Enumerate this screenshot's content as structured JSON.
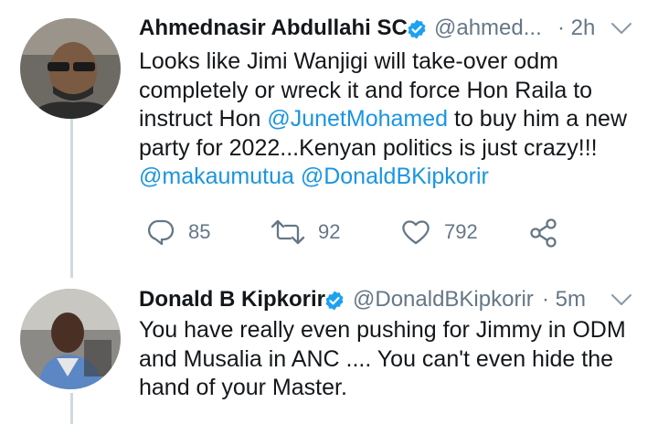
{
  "tweets": [
    {
      "name": "Ahmednasir Abdullahi SC",
      "handle": "@ahmed...",
      "time": "· 2h",
      "lines": [
        {
          "text": "Looks like Jimi Wanjigi will take-over odm"
        },
        {
          "text": "completely or wreck it and force Hon Raila to"
        },
        {
          "pre": "instruct Hon ",
          "mention": "@JunetMohamed",
          "post": " to buy him a new"
        },
        {
          "text": "party for 2022...Kenyan politics is just crazy!!!"
        },
        {
          "mentions": "@makaumutua @DonaldBKipkorir"
        }
      ],
      "actions": {
        "replies": "85",
        "retweets": "92",
        "likes": "792"
      }
    },
    {
      "name": "Donald B Kipkorir",
      "handle": "@DonaldBKipkorir",
      "time": "· 5m",
      "lines": [
        {
          "text": "You have really even pushing for Jimmy in ODM"
        },
        {
          "text": "and Musalia in ANC .... You can't even hide the"
        },
        {
          "text": "hand of your Master."
        }
      ]
    }
  ],
  "icons": {
    "reply": "reply-icon",
    "retweet": "retweet-icon",
    "like": "heart-icon",
    "share": "share-icon",
    "verified": "verified-badge-icon",
    "more": "chevron-down-icon"
  },
  "colors": {
    "text": "#14171a",
    "secondary": "#657786",
    "link": "#1b95e0",
    "verified": "#1da1f2",
    "thread": "#cfd9de"
  }
}
